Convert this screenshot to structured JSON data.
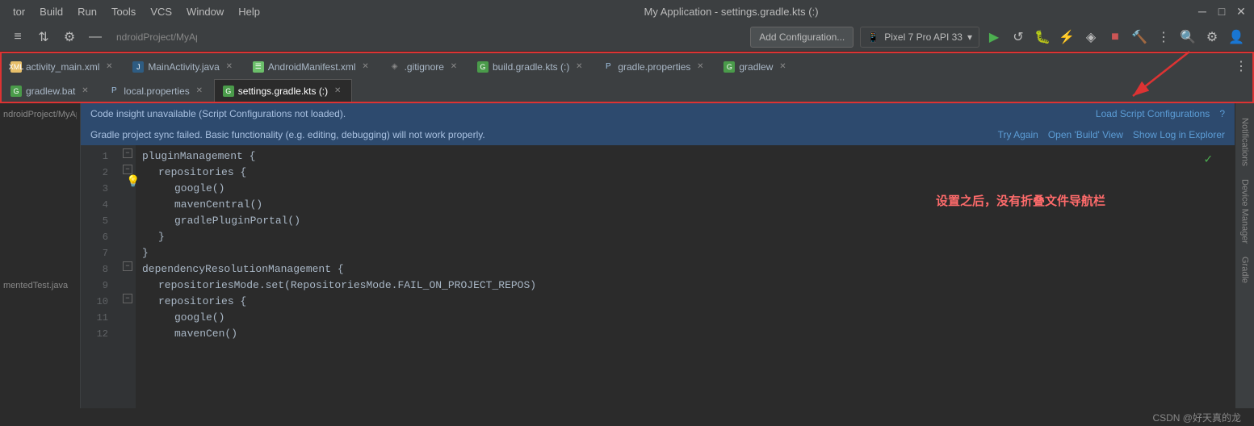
{
  "menubar": {
    "items": [
      "tor",
      "Build",
      "Run",
      "Tools",
      "VCS",
      "Window",
      "Help"
    ],
    "title": "My Application - settings.gradle.kts (:)"
  },
  "toolbar": {
    "run_config_label": "Add Configuration...",
    "device_label": "Pixel 7 Pro API 33",
    "run_icon": "▶",
    "icons": [
      "≡",
      "⇅",
      "⚙",
      "—"
    ]
  },
  "tabs_row1": [
    {
      "label": "activity_main.xml",
      "icon": "XML",
      "active": false
    },
    {
      "label": "MainActivity.java",
      "icon": "J",
      "active": false
    },
    {
      "label": "AndroidManifest.xml",
      "icon": "☰",
      "active": false
    },
    {
      "label": ".gitignore",
      "icon": "◈",
      "active": false
    },
    {
      "label": "build.gradle.kts (:)",
      "icon": "G",
      "active": false
    },
    {
      "label": "gradle.properties",
      "icon": "P",
      "active": false
    },
    {
      "label": "gradlew",
      "icon": "G",
      "active": false
    }
  ],
  "tabs_row2": [
    {
      "label": "gradlew.bat",
      "icon": "G",
      "active": false
    },
    {
      "label": "local.properties",
      "icon": "P",
      "active": false
    },
    {
      "label": "settings.gradle.kts (:)",
      "icon": "G",
      "active": true
    }
  ],
  "notifications": {
    "bar1_text": "Code insight unavailable (Script Configurations not loaded).",
    "bar1_link": "Load Script Configurations",
    "bar1_help": "?",
    "bar2_text": "Gradle project sync failed. Basic functionality (e.g. editing, debugging) will not work properly.",
    "bar2_link1": "Try Again",
    "bar2_link2": "Open 'Build' View",
    "bar2_link3": "Show Log in Explorer"
  },
  "code": {
    "lines": [
      {
        "num": 1,
        "indent": 0,
        "content": "pluginManagement {",
        "fold": true
      },
      {
        "num": 2,
        "indent": 1,
        "content": "repositories {",
        "fold": true,
        "has_bulb": true
      },
      {
        "num": 3,
        "indent": 2,
        "content": "google()"
      },
      {
        "num": 4,
        "indent": 2,
        "content": "mavenCentral()"
      },
      {
        "num": 5,
        "indent": 2,
        "content": "gradlePluginPortal()"
      },
      {
        "num": 6,
        "indent": 1,
        "content": "}"
      },
      {
        "num": 7,
        "indent": 0,
        "content": "}"
      },
      {
        "num": 8,
        "indent": 0,
        "content": "dependencyResolutionManagement {",
        "fold": true
      },
      {
        "num": 9,
        "indent": 1,
        "content": "repositoriesMode.set(RepositoriesMode.FAIL_ON_PROJECT_REPOS)"
      },
      {
        "num": 10,
        "indent": 1,
        "content": "repositories {",
        "fold": true
      },
      {
        "num": 11,
        "indent": 2,
        "content": "google()"
      },
      {
        "num": 12,
        "indent": 2,
        "content": "mavenCen()"
      }
    ]
  },
  "annotation": {
    "text": "设置之后，没有折叠文件导航栏",
    "color": "#ff6b6b"
  },
  "left_panel": {
    "breadcrumb": "ndroidProject/MyAp"
  },
  "left_panel_bottom": {
    "text": "mentedTest.java"
  },
  "right_sidebar": {
    "items": [
      "Notifications",
      "Device Manager",
      "Gradle"
    ]
  },
  "bottom_bar": {
    "watermark": "CSDN @好天真的龙"
  }
}
